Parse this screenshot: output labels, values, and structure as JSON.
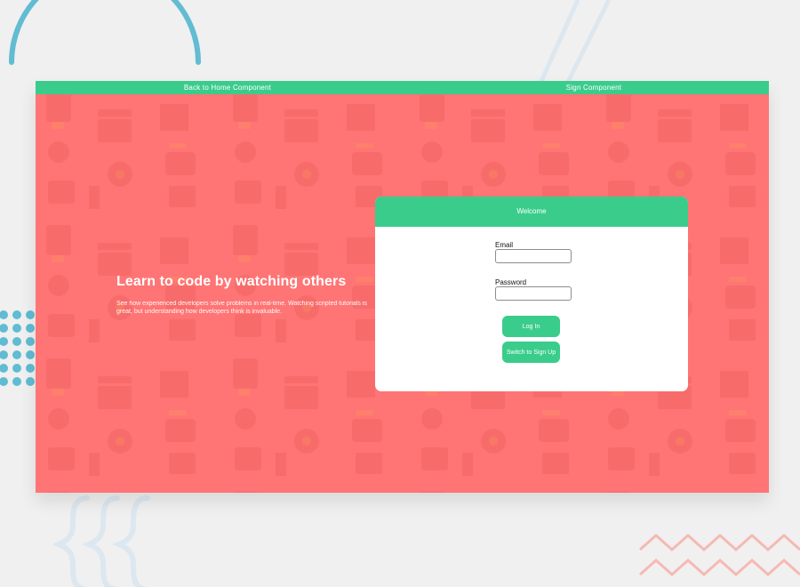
{
  "navbar": {
    "home_link": "Back to Home Component",
    "sign_link": "Sign Component"
  },
  "hero": {
    "title": "Learn to code by watching others",
    "description": "See how experienced developers solve problems in real-time. Watching scripted tutorials is great, but understanding how developers think is invaluable."
  },
  "login_card": {
    "header": "Welcome",
    "email_label": "Email",
    "email_value": "",
    "password_label": "Password",
    "password_value": "",
    "login_button": "Log In",
    "switch_button": "Switch to Sign Up"
  },
  "colors": {
    "page_background": "#f0f0f0",
    "hero_background": "#ff7474",
    "accent_green": "#3acc8b",
    "deco_blue": "#5fbcd3",
    "deco_pink": "#f6b7b3"
  }
}
